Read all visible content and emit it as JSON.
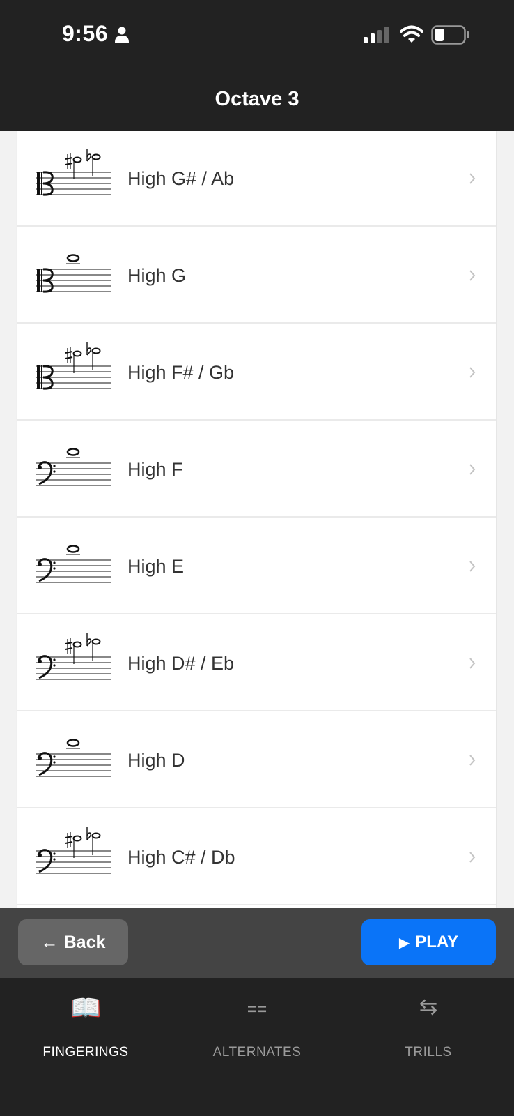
{
  "status_bar": {
    "time": "9:56"
  },
  "nav": {
    "title": "Octave 3"
  },
  "notes": [
    {
      "label": "High G# / Ab",
      "clef": "alto",
      "kind": "sharp-flat"
    },
    {
      "label": "High G",
      "clef": "alto",
      "kind": "whole"
    },
    {
      "label": "High F# / Gb",
      "clef": "alto",
      "kind": "sharp-flat"
    },
    {
      "label": "High F",
      "clef": "bass",
      "kind": "whole"
    },
    {
      "label": "High E",
      "clef": "bass",
      "kind": "whole"
    },
    {
      "label": "High D# / Eb",
      "clef": "bass",
      "kind": "sharp-flat"
    },
    {
      "label": "High D",
      "clef": "bass",
      "kind": "whole"
    },
    {
      "label": "High C# / Db",
      "clef": "bass",
      "kind": "sharp-flat"
    }
  ],
  "actions": {
    "back_label": "Back",
    "back_icon": "←",
    "play_label": "PLAY",
    "play_icon": "▶"
  },
  "tabs": [
    {
      "label": "FINGERINGS",
      "icon": "open-book-icon",
      "glyph": "📖",
      "active": true
    },
    {
      "label": "ALTERNATES",
      "icon": "alternates-icon",
      "glyph": "==",
      "active": false
    },
    {
      "label": "TRILLS",
      "icon": "swap-arrows-icon",
      "glyph": "⇆",
      "active": false
    }
  ],
  "colors": {
    "bar_dark": "#222222",
    "action_bar": "#444444",
    "play_blue": "#0a74f8",
    "back_gray": "#666666"
  }
}
